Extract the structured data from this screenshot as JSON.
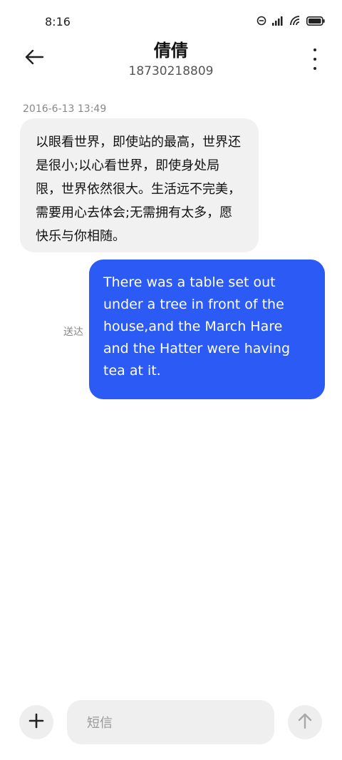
{
  "status_bar": {
    "time": "8:16",
    "icons": [
      "do-not-disturb-icon",
      "signal-icon",
      "wifi-icon",
      "battery-icon"
    ]
  },
  "header": {
    "contact_name": "倩倩",
    "contact_number": "18730218809",
    "back_icon": "back-arrow-icon",
    "more_icon": "more-vertical-icon"
  },
  "conversation": {
    "timestamp": "2016-6-13 13:49",
    "messages": [
      {
        "direction": "incoming",
        "text": "以眼看世界，即使站的最高，世界还是很小;以心看世界，即使身处局限，世界依然很大。生活远不完美，需要用心去体会;无需拥有太多，愿快乐与你相随。"
      },
      {
        "direction": "outgoing",
        "text": "There was a table set out under a tree in front of the house,and the March Hare and the Hatter were having tea at it.",
        "status": "送达"
      }
    ]
  },
  "composer": {
    "placeholder": "短信",
    "add_icon": "plus-icon",
    "send_icon": "arrow-up-icon"
  },
  "colors": {
    "outgoing_bubble": "#2b5af5",
    "incoming_bubble": "#f1f1f1",
    "background": "#ffffff"
  }
}
